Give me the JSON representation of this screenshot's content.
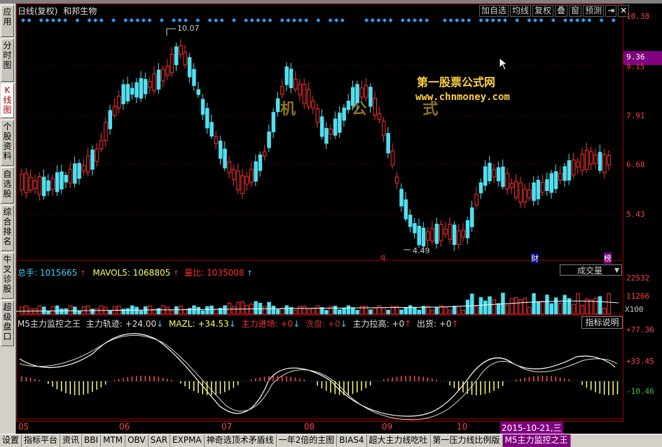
{
  "left_tabs": [
    "应用",
    "分时图",
    "K线图",
    "个股资料",
    "自选股",
    "综合排名",
    "牛叉诊股",
    "超级盘口"
  ],
  "header": {
    "period": "日线(复权)",
    "stock": "和邦生物"
  },
  "toolbar": [
    "加自选",
    "均线",
    "复权",
    "叠",
    "窗",
    "预测"
  ],
  "price_axis": [
    "10.38",
    "9.15",
    "7.91",
    "6.68",
    "5.43"
  ],
  "current_price": "9.36",
  "price_annotations": {
    "high": "10.07",
    "low": "4.49"
  },
  "markers": {
    "q": "q",
    "cai": "财",
    "bang": "榜"
  },
  "watermark": {
    "line1": "第一股票公式网",
    "line2": "www.chnmoney.com",
    "faint": "机 公 式"
  },
  "volume": {
    "label_total": "总手: 1015665",
    "label_mavol5": "MAVOL5: 1068805",
    "label_liang": "量比: 1035008",
    "dropdown": "成交量",
    "axis": [
      "22532",
      "11266",
      "X100"
    ]
  },
  "indicator": {
    "name": "M5主力监控之王",
    "track": "主力轨迹: +24.00",
    "mazl": "MAZL: +34.53",
    "enter": "主力进场: +0",
    "wash": "洗盘: +0",
    "lift": "主力拉高: +0",
    "ship": "出货: +0",
    "help": "指标说明",
    "axis": [
      "+77.36",
      "+33.45",
      "-10.46"
    ]
  },
  "date_axis": [
    "05",
    "06",
    "07",
    "08",
    "09",
    "10"
  ],
  "date_highlight": "2015-10-21,三",
  "bottom_tabs": [
    "设置",
    "指标平台",
    "资讯",
    "BBI",
    "MTM",
    "OBV",
    "SAR",
    "EXPMA",
    "神奇选顶术矛盾线",
    "一年2倍的主图",
    "BIAS4",
    "超大主力线吃吐",
    "第一压力线比例版",
    "M5主力监控之王"
  ],
  "colors": {
    "up": "#ff3030",
    "down": "#50e0f0",
    "axis": "#a00000"
  }
}
